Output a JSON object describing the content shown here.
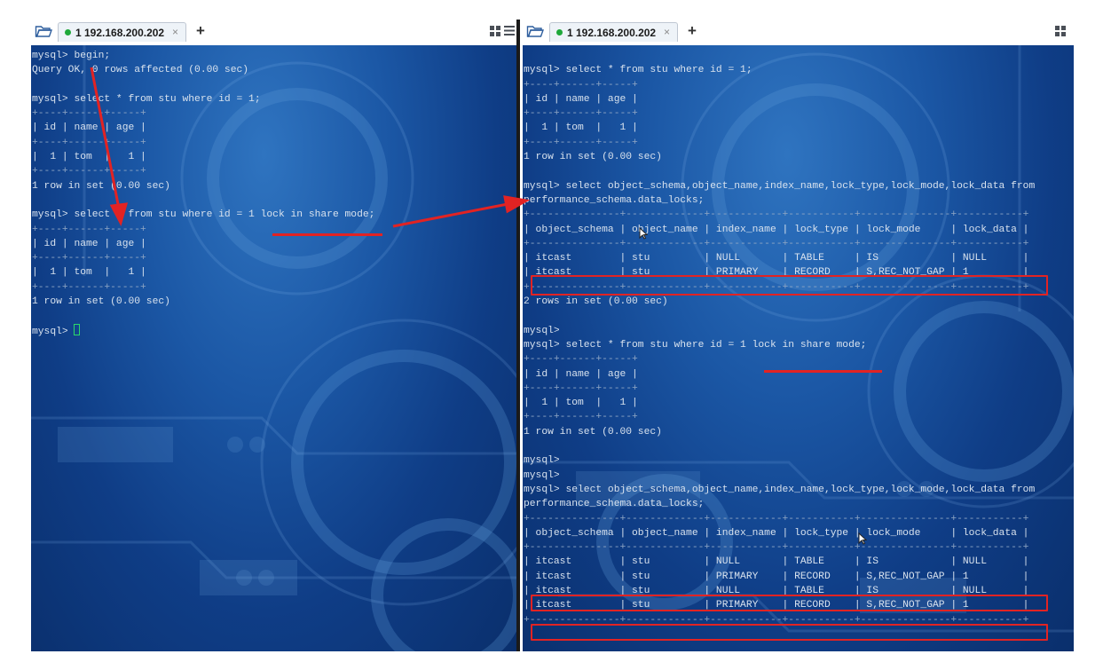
{
  "left": {
    "tab_title": "1 192.168.200.202",
    "tab_close": "×",
    "new_tab": "+",
    "lines": [
      "mysql> begin;",
      "Query OK, 0 rows affected (0.00 sec)",
      "",
      "mysql> select * from stu where id = 1;",
      "+----+------+-----+",
      "| id | name | age |",
      "+----+------+-----+",
      "|  1 | tom  |   1 |",
      "+----+------+-----+",
      "1 row in set (0.00 sec)",
      "",
      "mysql> select * from stu where id = 1 lock in share mode;",
      "+----+------+-----+",
      "| id | name | age |",
      "+----+------+-----+",
      "|  1 | tom  |   1 |",
      "+----+------+-----+",
      "1 row in set (0.00 sec)",
      "",
      "mysql> "
    ]
  },
  "right": {
    "tab_title": "1 192.168.200.202",
    "tab_close": "×",
    "new_tab": "+",
    "lines": [
      "",
      "mysql> select * from stu where id = 1;",
      "+----+------+-----+",
      "| id | name | age |",
      "+----+------+-----+",
      "|  1 | tom  |   1 |",
      "+----+------+-----+",
      "1 row in set (0.00 sec)",
      "",
      "mysql> select object_schema,object_name,index_name,lock_type,lock_mode,lock_data from",
      "performance_schema.data_locks;",
      "+---------------+-------------+------------+-----------+---------------+-----------+",
      "| object_schema | object_name | index_name | lock_type | lock_mode     | lock_data |",
      "+---------------+-------------+------------+-----------+---------------+-----------+",
      "| itcast        | stu         | NULL       | TABLE     | IS            | NULL      |",
      "| itcast        | stu         | PRIMARY    | RECORD    | S,REC_NOT_GAP | 1         |",
      "+---------------+-------------+------------+-----------+---------------+-----------+",
      "2 rows in set (0.00 sec)",
      "",
      "mysql>",
      "mysql> select * from stu where id = 1 lock in share mode;",
      "+----+------+-----+",
      "| id | name | age |",
      "+----+------+-----+",
      "|  1 | tom  |   1 |",
      "+----+------+-----+",
      "1 row in set (0.00 sec)",
      "",
      "mysql>",
      "mysql>",
      "mysql> select object_schema,object_name,index_name,lock_type,lock_mode,lock_data from",
      "performance_schema.data_locks;",
      "+---------------+-------------+------------+-----------+---------------+-----------+",
      "| object_schema | object_name | index_name | lock_type | lock_mode     | lock_data |",
      "+---------------+-------------+------------+-----------+---------------+-----------+",
      "| itcast        | stu         | NULL       | TABLE     | IS            | NULL      |",
      "| itcast        | stu         | PRIMARY    | RECORD    | S,REC_NOT_GAP | 1         |",
      "| itcast        | stu         | NULL       | TABLE     | IS            | NULL      |",
      "| itcast        | stu         | PRIMARY    | RECORD    | S,REC_NOT_GAP | 1         |",
      "+---------------+-------------+------------+-----------+---------------+-----------+"
    ]
  },
  "colors": {
    "annotation": "#e22323",
    "terminal_text": "#d8e2ee",
    "status_dot": "#1fa83a",
    "cursor": "#2bd96a"
  },
  "icons": [
    "folder-icon",
    "status-dot-icon",
    "close-icon",
    "plus-icon",
    "layout-grid-icon",
    "menu-icon",
    "arrow-annotation",
    "mouse-cursor-icon"
  ]
}
